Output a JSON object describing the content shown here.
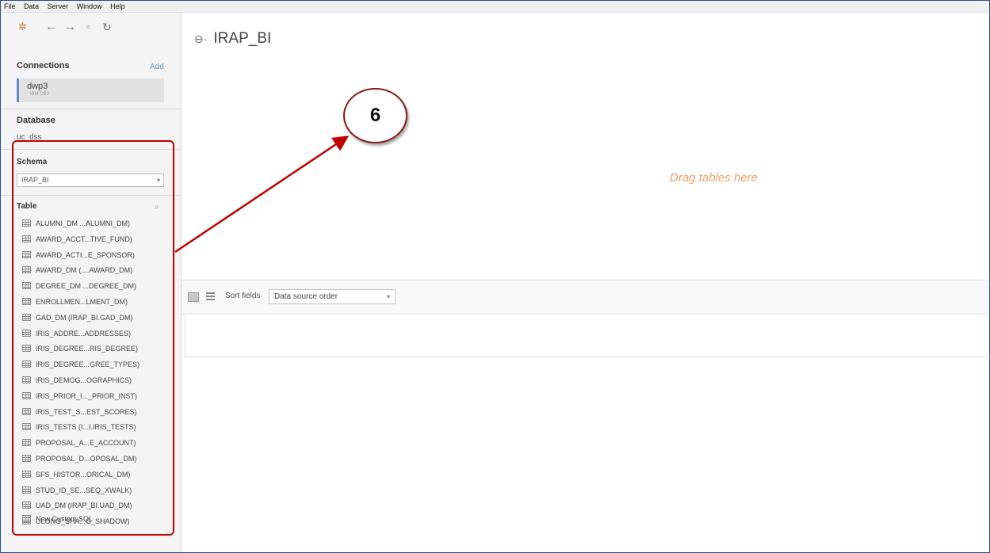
{
  "menu": [
    "File",
    "Data",
    "Server",
    "Window",
    "Help"
  ],
  "icons": {
    "logo": "tableau-logo-icon",
    "back": "back-arrow-icon",
    "forward": "forward-arrow-icon",
    "save": "save-icon",
    "refresh": "refresh-icon",
    "table": "table-icon",
    "search": "search-icon",
    "database": "database-icon",
    "custom_sql": "custom-sql-icon"
  },
  "sidebar": {
    "connections_title": "Connections",
    "add_label": "Add",
    "connection": {
      "name": "dwp3",
      "type": "IBM DB2"
    },
    "database_title": "Database",
    "database_value": "uc_dss",
    "schema_title": "Schema",
    "schema_value": "IRAP_BI",
    "table_title": "Table",
    "tables": [
      "ALUMNI_DM ...ALUMNI_DM)",
      "AWARD_ACCT...TIVE_FUND)",
      "AWARD_ACTI...E_SPONSOR)",
      "AWARD_DM (....AWARD_DM)",
      "DEGREE_DM ...DEGREE_DM)",
      "ENROLLMEN...LMENT_DM)",
      "GAD_DM (IRAP_BI.GAD_DM)",
      "IRIS_ADDRE...ADDRESSES)",
      "IRIS_DEGREE...RIS_DEGREE)",
      "IRIS_DEGREE...GREE_TYPES)",
      "IRIS_DEMOG...OGRAPHICS)",
      "IRIS_PRIOR_I..._PRIOR_INST)",
      "IRIS_TEST_S...EST_SCORES)",
      "IRIS_TESTS (I...I.IRIS_TESTS)",
      "PROPOSAL_A...E_ACCOUNT)",
      "PROPOSAL_D...OPOSAL_DM)",
      "SFS_HISTOR...ORICAL_DM)",
      "STUD_ID_SE...SEQ_XWALK)",
      "UAD_DM (IRAP_BI.UAD_DM)",
      "ULONG_SHA...G_SHADOW)"
    ],
    "custom_sql_label": "New Custom SQL"
  },
  "canvas": {
    "title": "IRAP_BI",
    "drop_hint": "Drag tables here"
  },
  "grid": {
    "sort_label": "Sort fields",
    "sort_value": "Data source order"
  },
  "annotation": {
    "step_number": "6",
    "color": "#c00000"
  }
}
